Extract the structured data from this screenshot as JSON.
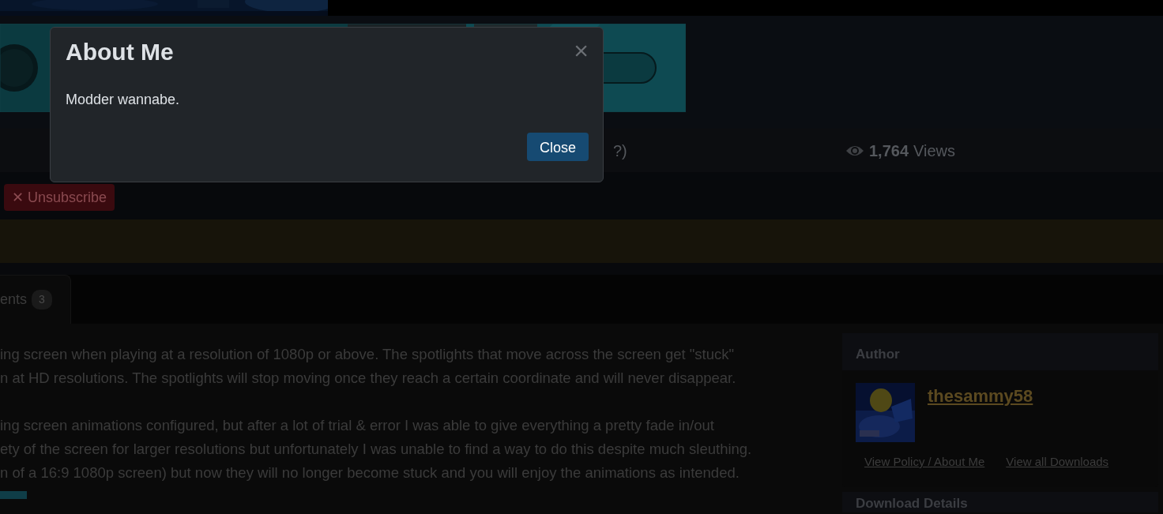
{
  "top_strip": {
    "kind": "picture"
  },
  "ad_banner": {
    "kind": "picture"
  },
  "stats": {
    "partial_text": "?)",
    "views_count": "1,764",
    "views_label": "Views"
  },
  "unsubscribe_button": {
    "icon": "✕",
    "label": "Unsubscribe"
  },
  "tabs": [
    {
      "label": "ents",
      "count": "3",
      "selected": true
    }
  ],
  "description": {
    "paragraphs": [
      [
        "ing screen when playing at a resolution of 1080p or above. The spotlights that move across the screen get \"stuck\"",
        "n at HD resolutions. The spotlights will stop moving once they reach a certain coordinate and will never disappear."
      ],
      [
        "ing screen animations configured, but after a lot of trial & error I was able to give everything a pretty fade in/out",
        "ety of the screen for larger resolutions but unfortunately I was unable to find a way to do this despite much sleuthing.",
        "n of a 16:9 1080p screen) but now they will no longer become stuck and you will enjoy the animations as intended."
      ]
    ]
  },
  "author_card": {
    "title": "Author",
    "avatar": {
      "kind": "picture"
    },
    "username": "thesammy58",
    "links": [
      "View Policy / About Me",
      "View all Downloads"
    ]
  },
  "details_card": {
    "title": "Download Details"
  },
  "modal": {
    "title": "About Me",
    "close_icon": "×",
    "body": "Modder wannabe.",
    "button": "Close"
  }
}
